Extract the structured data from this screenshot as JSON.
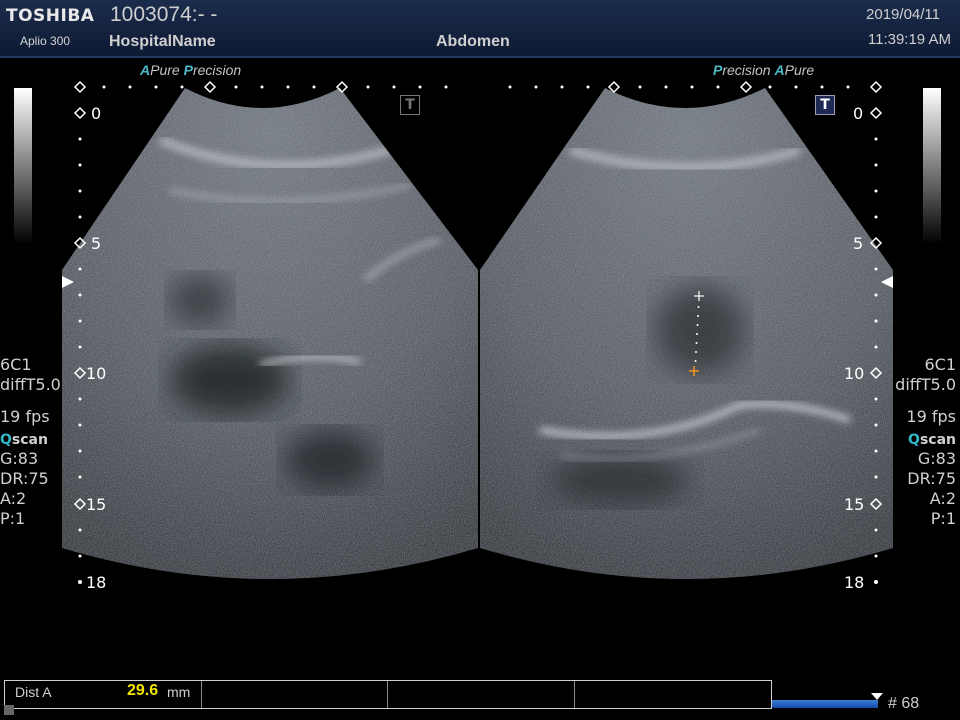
{
  "header": {
    "brand": "TOSHIBA",
    "model": "Aplio 300",
    "patient_id": "1003074:- -",
    "hospital": "HospitalName",
    "exam": "Abdomen",
    "date": "2019/04/11",
    "time": "11:39:19 AM"
  },
  "taglines": {
    "left": {
      "a": "A",
      "pure": "Pure",
      "p": "P",
      "precision": "recision"
    },
    "right": {
      "p": "P",
      "precision": "recision",
      "a": "A",
      "pure": "Pure"
    }
  },
  "depth_scale": {
    "left": [
      "0",
      "5",
      "10",
      "15",
      "18"
    ],
    "right": [
      "0",
      "5",
      "10",
      "15",
      "18"
    ]
  },
  "params": {
    "probe": "6C1",
    "preset": "diffT5.0",
    "fps": "19 fps",
    "q": "Q",
    "scan": "scan",
    "gain": "G:83",
    "dr": "DR:75",
    "a": "A:2",
    "p": "P:1"
  },
  "t_mark_label": "T",
  "measurement": {
    "label": "Dist A",
    "value": "29.6",
    "unit": "mm"
  },
  "cine_progress": 0.97,
  "frame": "# 68",
  "colors": {
    "header_bg": "#1b2c4c",
    "accent": "#4fb8c8",
    "measure_value": "#f4e400",
    "caliper": "#ff9a1a"
  }
}
